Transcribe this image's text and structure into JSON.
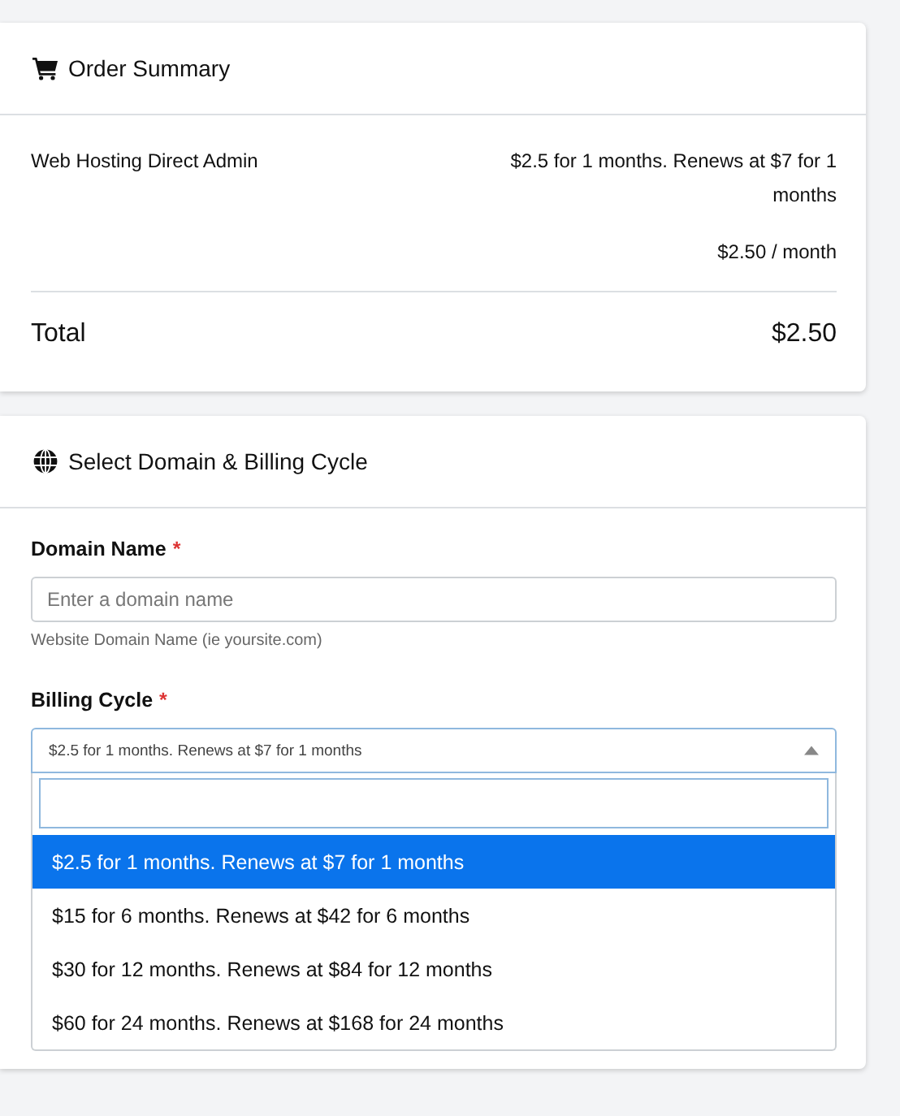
{
  "order_summary": {
    "title": "Order Summary",
    "items": [
      {
        "name": "Web Hosting Direct Admin",
        "description": "$2.5 for 1 months. Renews at $7 for 1 months",
        "price": "$2.50 / month"
      }
    ],
    "total": {
      "label": "Total",
      "value": "$2.50"
    }
  },
  "domain_billing": {
    "title": "Select Domain & Billing Cycle",
    "domain_field": {
      "label": "Domain Name",
      "required_mark": "*",
      "placeholder": "Enter a domain name",
      "help": "Website Domain Name (ie yoursite.com)"
    },
    "billing_cycle": {
      "label": "Billing Cycle",
      "required_mark": "*",
      "value": "$2.5 for 1 months. Renews at $7 for 1 months",
      "expanded": true,
      "options": [
        {
          "label": "$2.5 for 1 months. Renews at $7 for 1 months",
          "selected": true
        },
        {
          "label": "$15 for 6 months. Renews at $42 for 6 months",
          "selected": false
        },
        {
          "label": "$30 for 12 months. Renews at $84 for 12 months",
          "selected": false
        },
        {
          "label": "$60 for 24 months. Renews at $168 for 24 months",
          "selected": false
        }
      ]
    }
  }
}
